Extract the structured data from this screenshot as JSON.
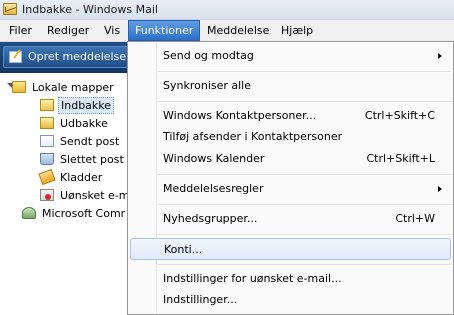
{
  "window": {
    "title": "Indbakke - Windows Mail"
  },
  "menubar": {
    "items": [
      "Filer",
      "Rediger",
      "Vis",
      "Funktioner",
      "Meddelelse",
      "Hjælp"
    ]
  },
  "toolbar": {
    "compose_label": "Opret meddelelse"
  },
  "folders": {
    "root": "Lokale mapper",
    "inbox": "Indbakke",
    "outbox": "Udbakke",
    "sent": "Sendt post",
    "deleted": "Slettet post",
    "drafts": "Kladder",
    "junk": "Uønsket e-m",
    "community": "Microsoft Comr"
  },
  "menu": {
    "send_receive": "Send og modtag",
    "sync_all": "Synkroniser alle",
    "contacts": "Windows Kontaktpersoner...",
    "contacts_shortcut": "Ctrl+Skift+C",
    "add_sender": "Tilføj afsender i Kontaktpersoner",
    "calendar": "Windows Kalender",
    "calendar_shortcut": "Ctrl+Skift+L",
    "rules": "Meddelelsesregler",
    "newsgroups": "Nyhedsgrupper...",
    "newsgroups_shortcut": "Ctrl+W",
    "accounts": "Konti...",
    "junk_options": "Indstillinger for uønsket e-mail...",
    "options": "Indstillinger..."
  }
}
